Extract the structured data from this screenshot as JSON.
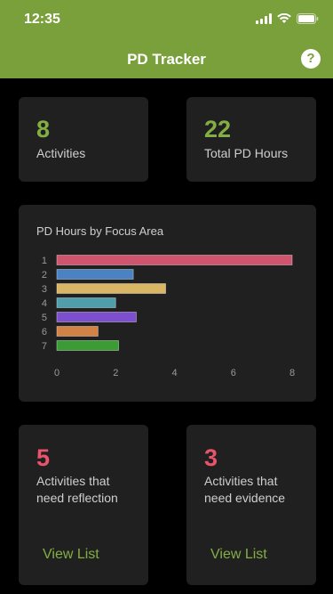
{
  "status_bar": {
    "time": "12:35"
  },
  "header": {
    "title": "PD Tracker",
    "help_icon": "question-circle-icon",
    "help_glyph": "?"
  },
  "stats": {
    "activities": {
      "value": "8",
      "label": "Activities"
    },
    "hours": {
      "value": "22",
      "label": "Total PD Hours"
    }
  },
  "chart_data": {
    "type": "bar",
    "orientation": "horizontal",
    "title": "PD Hours by Focus Area",
    "categories": [
      "1",
      "2",
      "3",
      "4",
      "5",
      "6",
      "7"
    ],
    "values": [
      8,
      2.6,
      3.7,
      2,
      2.7,
      1.4,
      2.1
    ],
    "colors": [
      "#d0546e",
      "#4a82c4",
      "#d9b564",
      "#4e9eab",
      "#7d4fcf",
      "#d38245",
      "#3b9c35"
    ],
    "xticks": [
      "0",
      "2",
      "4",
      "6",
      "8"
    ],
    "xlim": [
      0,
      8
    ],
    "grid": false
  },
  "reflection": {
    "value": "5",
    "label_line1": "Activities that",
    "label_line2": "need reflection",
    "link": "View List"
  },
  "evidence": {
    "value": "3",
    "label_line1": "Activities that",
    "label_line2": "need evidence",
    "link": "View List"
  },
  "colors": {
    "accent": "#7aa03c",
    "alert": "#e9546b",
    "card": "#202020",
    "background": "#000000"
  }
}
